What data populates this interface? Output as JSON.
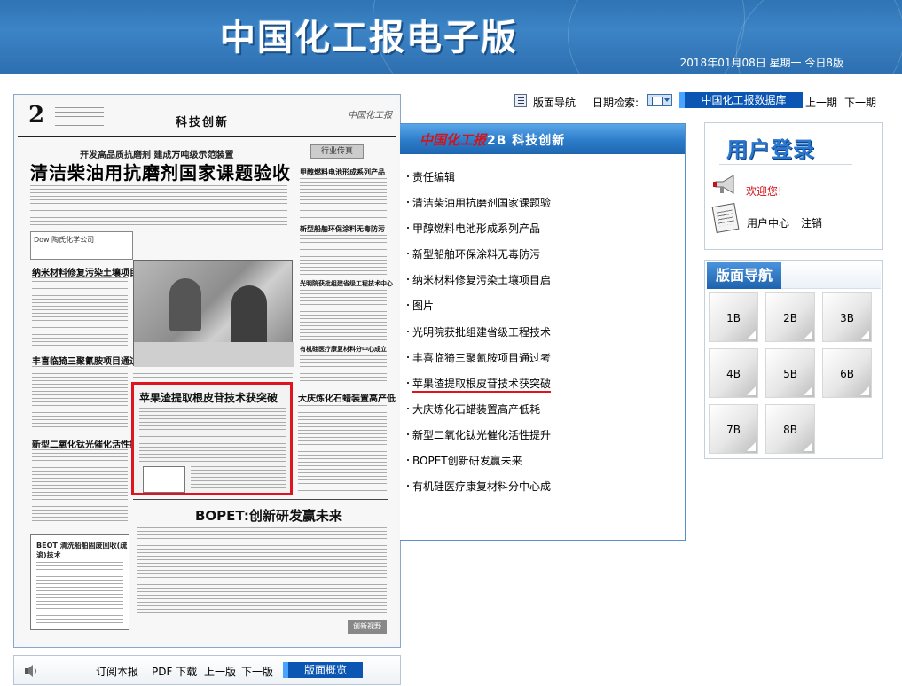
{
  "header": {
    "site_title": "中国化工报电子版",
    "date_line": "2018年01月08日 星期一 今日8版"
  },
  "toolbar": {
    "page_nav_label": "版面导航",
    "date_search_label": "日期检索:",
    "database_button": "中国化工报数据库",
    "prev_issue": "上一期",
    "next_issue": "下一期"
  },
  "newspaper_page": {
    "page_number": "2",
    "section_name": "科技创新",
    "masthead": "中国化工报",
    "subheadline": "开发高品质抗磨剂 建成万吨级示范装置",
    "main_headline": "清洁柴油用抗磨剂国家课题验收",
    "side_tag": "行业传真",
    "ad_text": "Dow 陶氏化学公司",
    "headlines": [
      "甲醇燃料电池形成系列产品",
      "新型船舶环保涂料无毒防污",
      "光明院获批组建省级工程技术中心",
      "有机硅医疗康复材料分中心成立",
      "纳米材料修复污染土壤项目启动",
      "丰喜临猗三聚氰胺项目通过考核",
      "大庆炼化石蜡装置高产低耗",
      "新型二氧化钛光催化活性提升"
    ],
    "highlight_headline": "苹果渣提取根皮苷技术获突破",
    "bopet_headline": "BOPET:创新研发赢未来",
    "ad2_title": "BEOT 清洗船舶固废回收(疏浚)技术",
    "stamp": "创新视野"
  },
  "bottom_bar": {
    "subscribe": "订阅本报",
    "pdf_download": "PDF 下载",
    "prev_page": "上一版",
    "next_page": "下一版",
    "overview_button": "版面概览"
  },
  "article_panel": {
    "logo": "中国化工报",
    "edition": "2B 科技创新",
    "items": [
      "责任编辑",
      "清洁柴油用抗磨剂国家课题验",
      "甲醇燃料电池形成系列产品",
      "新型船舶环保涂料无毒防污",
      "纳米材料修复污染土壤项目启",
      "图片",
      "光明院获批组建省级工程技术",
      "丰喜临猗三聚氰胺项目通过考",
      "苹果渣提取根皮苷技术获突破",
      "大庆炼化石蜡装置高产低耗",
      "新型二氧化钛光催化活性提升",
      "BOPET创新研发赢未来",
      "有机硅医疗康复材料分中心成"
    ],
    "active_index": 8
  },
  "login": {
    "title": "用户登录",
    "welcome": "欢迎您!",
    "user_center": "用户中心",
    "logout": "注销"
  },
  "page_nav": {
    "title": "版面导航",
    "pages": [
      "1B",
      "2B",
      "3B",
      "4B",
      "5B",
      "6B",
      "7B",
      "8B"
    ]
  },
  "colors": {
    "banner_blue": "#2f74b5",
    "button_blue": "#0b56b3",
    "highlight_red": "#e0141e"
  },
  "icons": {
    "page_nav": "list-icon",
    "date": "calendar-icon",
    "speaker": "speaker-icon",
    "welcome": "megaphone-icon",
    "user_center": "newspaper-icon"
  }
}
